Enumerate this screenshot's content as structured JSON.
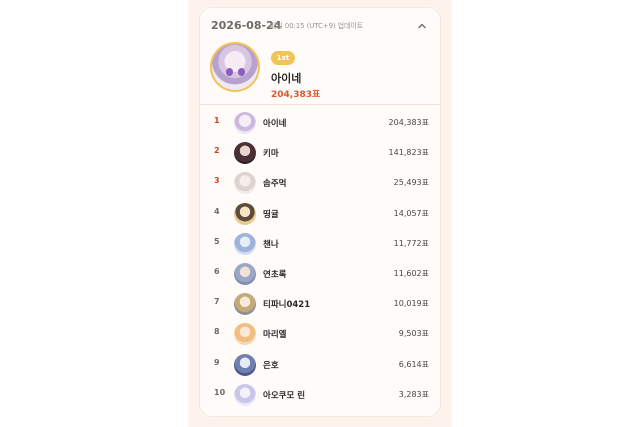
{
  "header": {
    "date": "2026-08-24",
    "update_text": "매일 00:15 (UTC+9) 업데이트"
  },
  "winner": {
    "badge": "1st",
    "name": "아이네",
    "votes": "204,383표"
  },
  "ranking": [
    {
      "rank": "1",
      "name": "아이네",
      "votes": "204,383표"
    },
    {
      "rank": "2",
      "name": "키마",
      "votes": "141,823표"
    },
    {
      "rank": "3",
      "name": "솜주먹",
      "votes": "25,493표"
    },
    {
      "rank": "4",
      "name": "띵귤",
      "votes": "14,057표"
    },
    {
      "rank": "5",
      "name": "챈나",
      "votes": "11,772표"
    },
    {
      "rank": "6",
      "name": "연초록",
      "votes": "11,602표"
    },
    {
      "rank": "7",
      "name": "티파니0421",
      "votes": "10,019표"
    },
    {
      "rank": "8",
      "name": "마리엘",
      "votes": "9,503표"
    },
    {
      "rank": "9",
      "name": "은호",
      "votes": "6,614표"
    },
    {
      "rank": "10",
      "name": "아오쿠모 린",
      "votes": "3,283표"
    }
  ],
  "colors": {
    "accent_badge": "#f1c45a",
    "top_rank": "#cf3f2a",
    "winner_votes": "#d9572d"
  }
}
